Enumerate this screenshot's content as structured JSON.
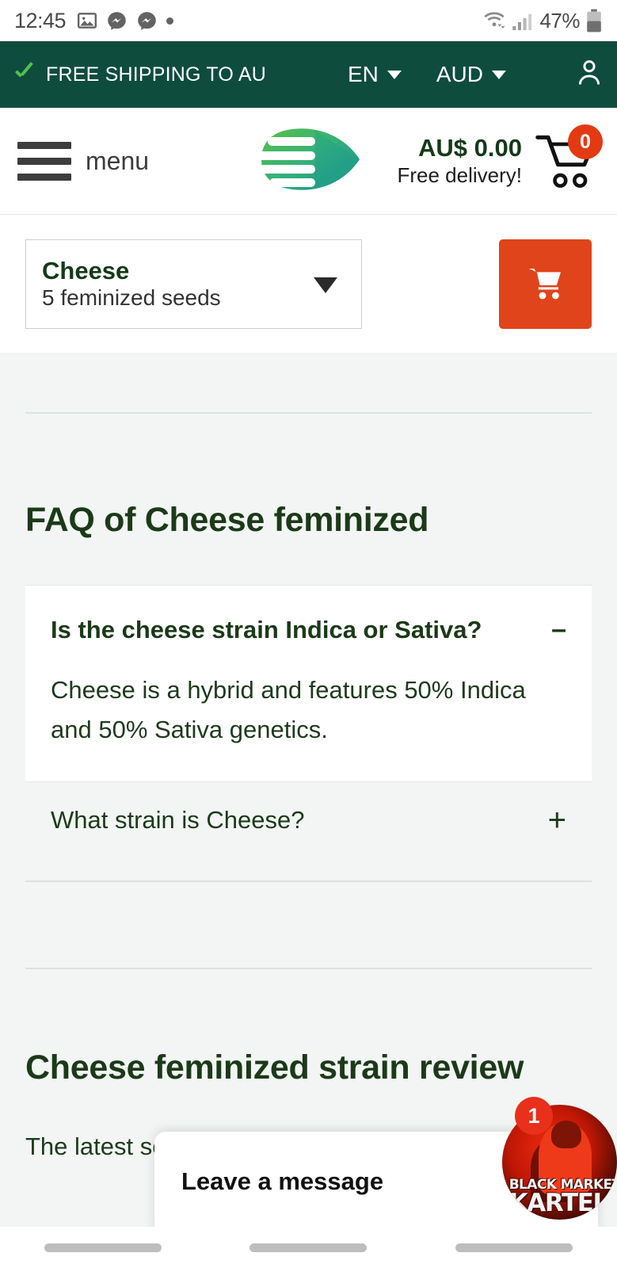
{
  "status_bar": {
    "time": "12:45",
    "battery_percent": "47%",
    "icons": [
      "gallery-icon",
      "messenger-icon",
      "messenger-icon",
      "dot-icon",
      "wifi-icon",
      "cellular-signal-icon",
      "battery-icon"
    ]
  },
  "top_banner": {
    "shipping_text": "FREE SHIPPING TO AU",
    "check_icon": "check-icon",
    "language": "EN",
    "currency": "AUD",
    "account_icon": "user-account-icon",
    "background_color": "#0e4c3e",
    "check_color": "#4fc24f"
  },
  "header": {
    "menu_label": "menu",
    "menu_icon": "hamburger-menu-icon",
    "logo_icon": "leaf-logo-icon",
    "cart_total": "AU$ 0.00",
    "delivery_note": "Free delivery!",
    "cart_icon": "shopping-cart-icon",
    "cart_count": "0",
    "badge_color": "#e33a13"
  },
  "selector": {
    "variant_title": "Cheese",
    "variant_subtitle": "5  feminized seeds",
    "dropdown_icon": "chevron-down-icon",
    "add_to_cart_icon": "shopping-cart-icon",
    "add_to_cart_color": "#e0441b"
  },
  "faq": {
    "heading": "FAQ of Cheese feminized",
    "items": [
      {
        "question": "Is the cheese strain Indica or Sativa?",
        "toggle": "–",
        "answer": "Cheese is a hybrid and features 50% Indica and 50% Sativa genetics.",
        "expanded": true
      },
      {
        "question": "What strain is Cheese?",
        "toggle": "+",
        "answer": "",
        "expanded": false
      }
    ]
  },
  "review": {
    "heading": "Cheese feminized strain review",
    "body": "The latest                                seeds, do y"
  },
  "chat_widget": {
    "title": "Leave a message",
    "unread_badge": "1",
    "avatar_line1": "BLACK MARKET",
    "avatar_line2": "KARTEL",
    "avatar_icon": "chat-agent-avatar"
  },
  "nav_bar": {
    "pills": [
      "recents-pill",
      "home-pill",
      "back-pill"
    ]
  }
}
